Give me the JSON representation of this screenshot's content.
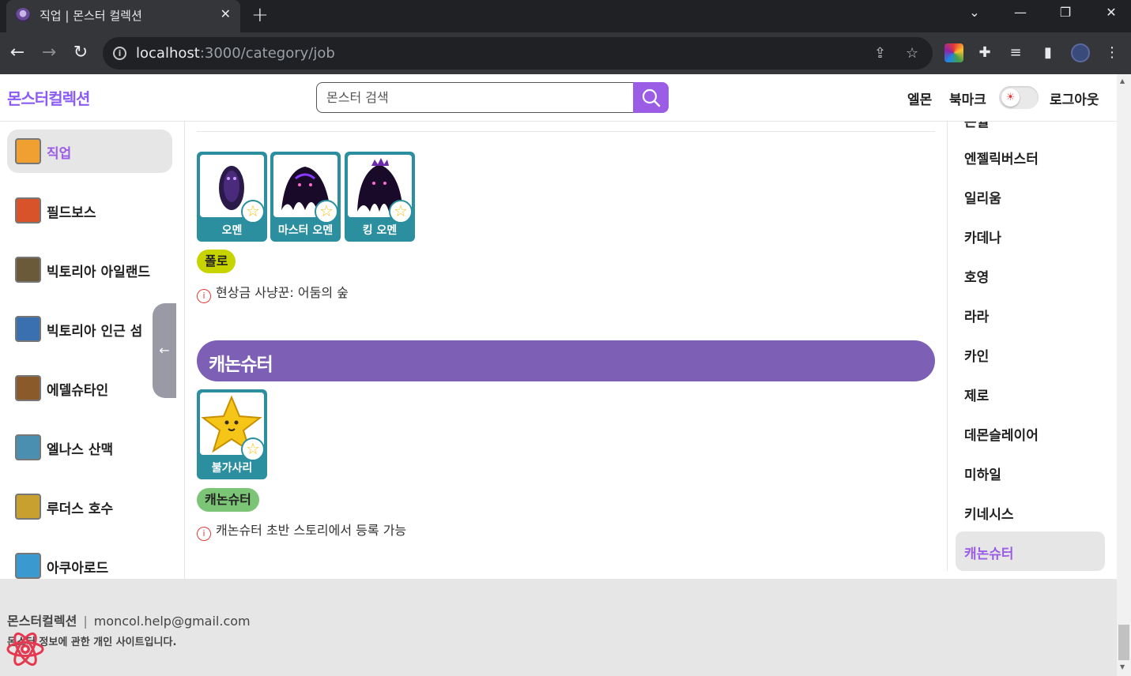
{
  "browser": {
    "tab_title": "직업 | 몬스터 컬렉션",
    "url_host": "localhost",
    "url_rest": ":3000/category/job"
  },
  "header": {
    "logo": "몬스터컬렉션",
    "search_placeholder": "몬스터 검색",
    "link_elmon": "엘몬",
    "link_bookmark": "북마크",
    "link_logout": "로그아웃"
  },
  "left_sidebar": {
    "items": [
      {
        "label": "직업",
        "active": true,
        "color": "#f0a030"
      },
      {
        "label": "필드보스",
        "color": "#d9532a"
      },
      {
        "label": "빅토리아 아일랜드",
        "color": "#6a5a3a"
      },
      {
        "label": "빅토리아 인근 섬",
        "color": "#3a6fb0"
      },
      {
        "label": "에델슈타인",
        "color": "#8a5a2a"
      },
      {
        "label": "엘나스 산맥",
        "color": "#4a8fb0"
      },
      {
        "label": "루더스 호수",
        "color": "#c8a030"
      },
      {
        "label": "아쿠아로드",
        "color": "#3a9ad0"
      }
    ],
    "collapse_icon": "←"
  },
  "main": {
    "group1": {
      "mobs": [
        {
          "name": "오멘"
        },
        {
          "name": "마스터 오멘"
        },
        {
          "name": "킹 오멘"
        }
      ],
      "tag": "폴로",
      "tag_color": "#c8d400",
      "info": "현상금 사냥꾼: 어둠의 숲"
    },
    "section_title": "캐논슈터",
    "group2": {
      "mobs": [
        {
          "name": "불가사리"
        }
      ],
      "tag": "캐논슈터",
      "tag_color": "#7cc576",
      "info": "캐논슈터 초반 스토리에서 등록 가능"
    }
  },
  "right_sidebar": {
    "partial_top": "은월",
    "items": [
      {
        "label": "엔젤릭버스터"
      },
      {
        "label": "일리움"
      },
      {
        "label": "카데나"
      },
      {
        "label": "호영"
      },
      {
        "label": "라라"
      },
      {
        "label": "카인"
      },
      {
        "label": "제로"
      },
      {
        "label": "데몬슬레이어"
      },
      {
        "label": "미하일"
      },
      {
        "label": "키네시스"
      },
      {
        "label": "캐논슈터",
        "active": true
      }
    ]
  },
  "footer": {
    "name": "몬스터컬렉션",
    "separator": "|",
    "email": "moncol.help@gmail.com",
    "desc": "몬스터 정보에 관한 개인 사이트입니다."
  },
  "colors": {
    "accent": "#9b5de5",
    "section_bar": "#7d5fb5",
    "card": "#2b8fa0"
  }
}
